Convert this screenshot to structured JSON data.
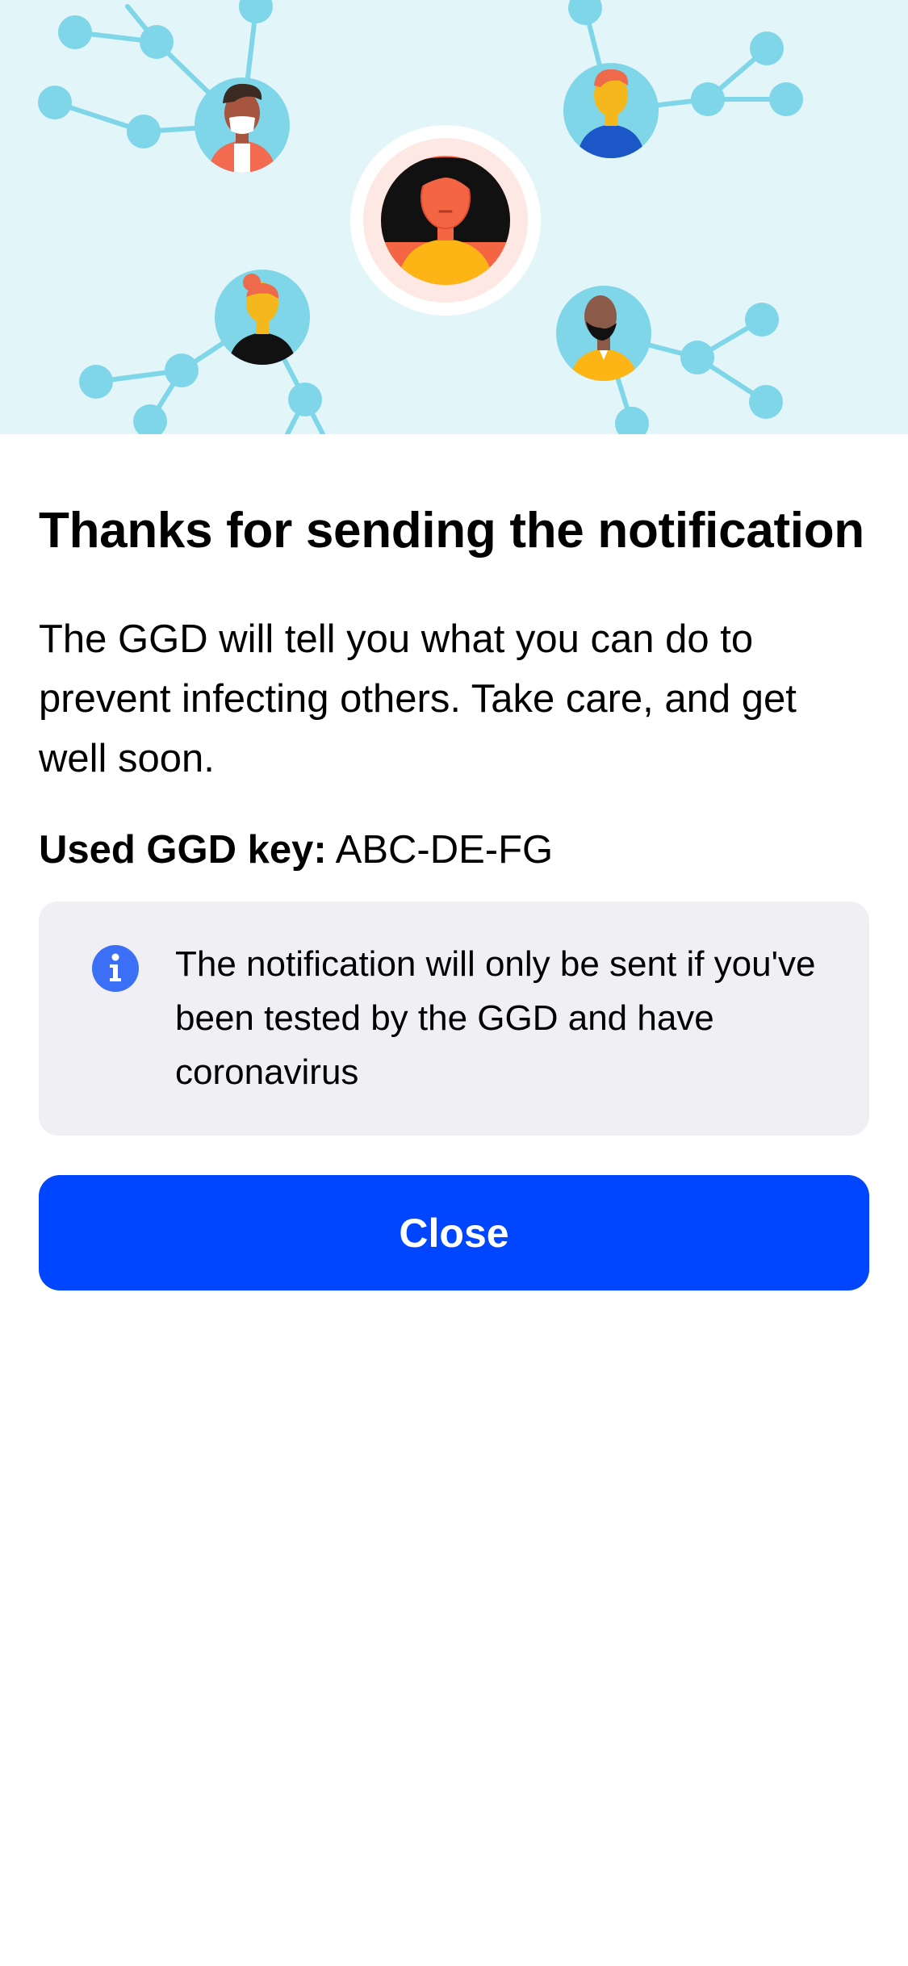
{
  "colors": {
    "hero_background": "#e2f5f9",
    "network_node": "#7ed6e8",
    "primary_button": "#0045ff",
    "info_card_background": "#efeff4",
    "info_icon": "#3b6ff5"
  },
  "hero": {
    "illustration": "contact-network-people-illustration"
  },
  "main": {
    "title": "Thanks for sending the notification",
    "body": "The GGD will tell you what you can do to prevent infecting others. Take care, and get well soon.",
    "key_label": "Used GGD key:",
    "key_value": "ABC-DE-FG"
  },
  "info_card": {
    "icon": "info-icon",
    "text": "The notification will only be sent if you've been tested by the GGD and have coronavirus"
  },
  "actions": {
    "close_label": "Close"
  }
}
